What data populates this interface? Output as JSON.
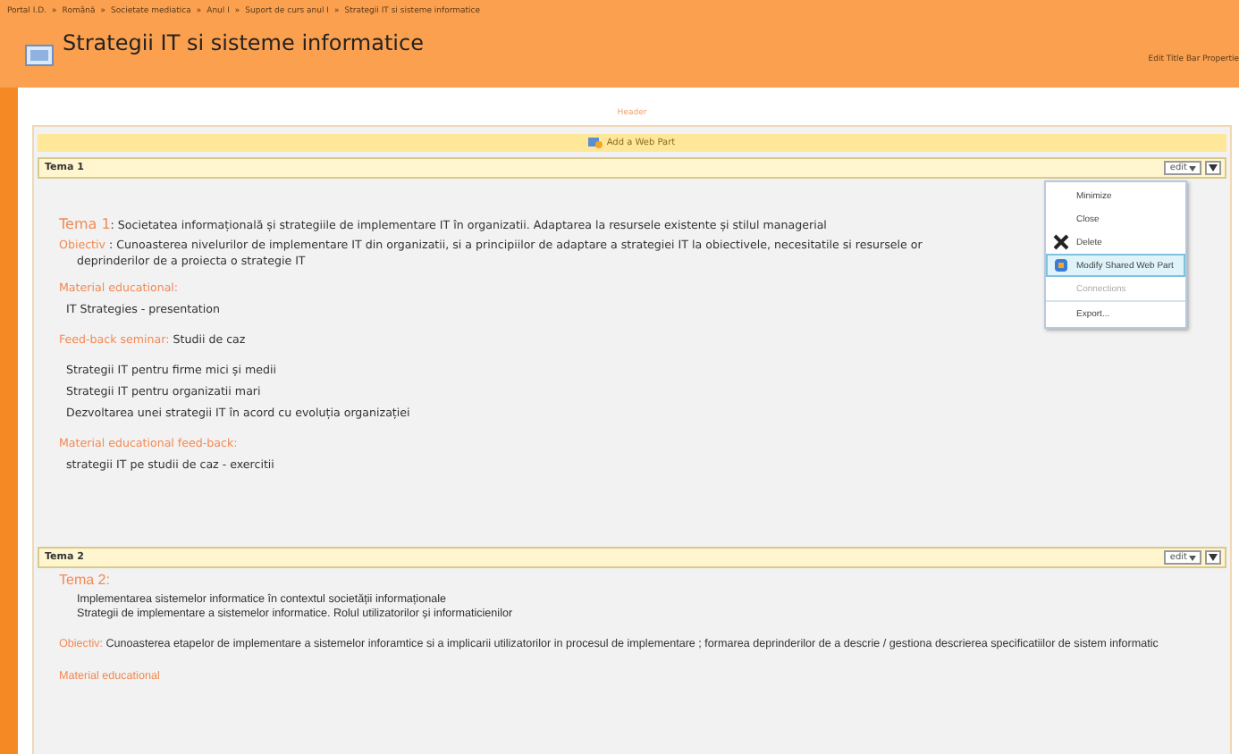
{
  "breadcrumb": {
    "separator": "»",
    "items": [
      "Portal I.D.",
      "Română",
      "Societate mediatica",
      "Anul I",
      "Suport de curs anul I",
      "Strategii IT si sisteme informatice"
    ]
  },
  "title": "Strategii IT si sisteme informatice",
  "title_bar_link": "Edit Title Bar Propertie",
  "zone_label": "Header",
  "add_web_part": "Add a Web Part",
  "web_parts": [
    {
      "title": "Tema 1",
      "edit": "edit",
      "blocks": [
        {
          "kind": "heading",
          "label": "Tema 1",
          "text": ": Societatea informațională și strategiile de implementare IT în organizatii. Adaptarea la resursele existente și stilul managerial"
        },
        {
          "kind": "labeled",
          "label": "Obiectiv",
          "lines": [
            ": Cunoasterea nivelurilor de implementare IT din organizatii, si a principiilor de adaptare a strategiei IT la obiectivele, necesitatile si resursele or",
            "deprinderilor de a proiecta o strategie IT"
          ]
        },
        {
          "kind": "label",
          "label": "Material educational:"
        },
        {
          "kind": "lines",
          "lines": [
            "IT Strategies - presentation"
          ]
        },
        {
          "kind": "labeled",
          "label": "Feed-back seminar:",
          "lines": [
            "Studii de caz"
          ]
        },
        {
          "kind": "lines",
          "lines": [
            "Strategii IT pentru firme mici și medii",
            "Strategii IT pentru organizatii mari",
            "Dezvoltarea unei strategii IT în acord cu evoluția organizației"
          ]
        },
        {
          "kind": "label",
          "label": "Material educational feed-back:"
        },
        {
          "kind": "lines",
          "lines": [
            "strategii IT pe studii de caz - exercitii"
          ]
        }
      ]
    },
    {
      "title": "Tema 2",
      "edit": "edit",
      "blocks": [
        {
          "kind": "heading",
          "label": "Tema 2:"
        },
        {
          "kind": "lines",
          "lines": [
            "Implementarea sistemelor informatice în contextul societății informaționale",
            "Strategii de implementare a sistemelor informatice. Rolul utilizatorilor și informaticienilor"
          ]
        },
        {
          "kind": "labeled",
          "label": "Obiectiv:",
          "lines": [
            "Cunoasterea etapelor de implementare a sistemelor inforamtice si a implicarii utilizatorilor in procesul de implementare ; formarea deprinderilor de a descrie / gestiona descrierea specificatiilor de sistem informatic"
          ]
        },
        {
          "kind": "label",
          "label": "Material educational"
        }
      ]
    }
  ],
  "menu": [
    {
      "label": "Minimize",
      "kind": "plain",
      "selected": false,
      "disabled": false
    },
    {
      "label": "Close",
      "kind": "plain",
      "selected": false,
      "disabled": false
    },
    {
      "label": "Delete",
      "kind": "delete",
      "selected": false,
      "disabled": false
    },
    {
      "label": "Modify Shared Web Part",
      "kind": "modify",
      "selected": true,
      "disabled": false
    },
    {
      "label": "Connections",
      "kind": "plain",
      "selected": false,
      "disabled": true
    },
    {
      "label": "Export...",
      "kind": "plain",
      "selected": false,
      "disabled": false
    }
  ]
}
